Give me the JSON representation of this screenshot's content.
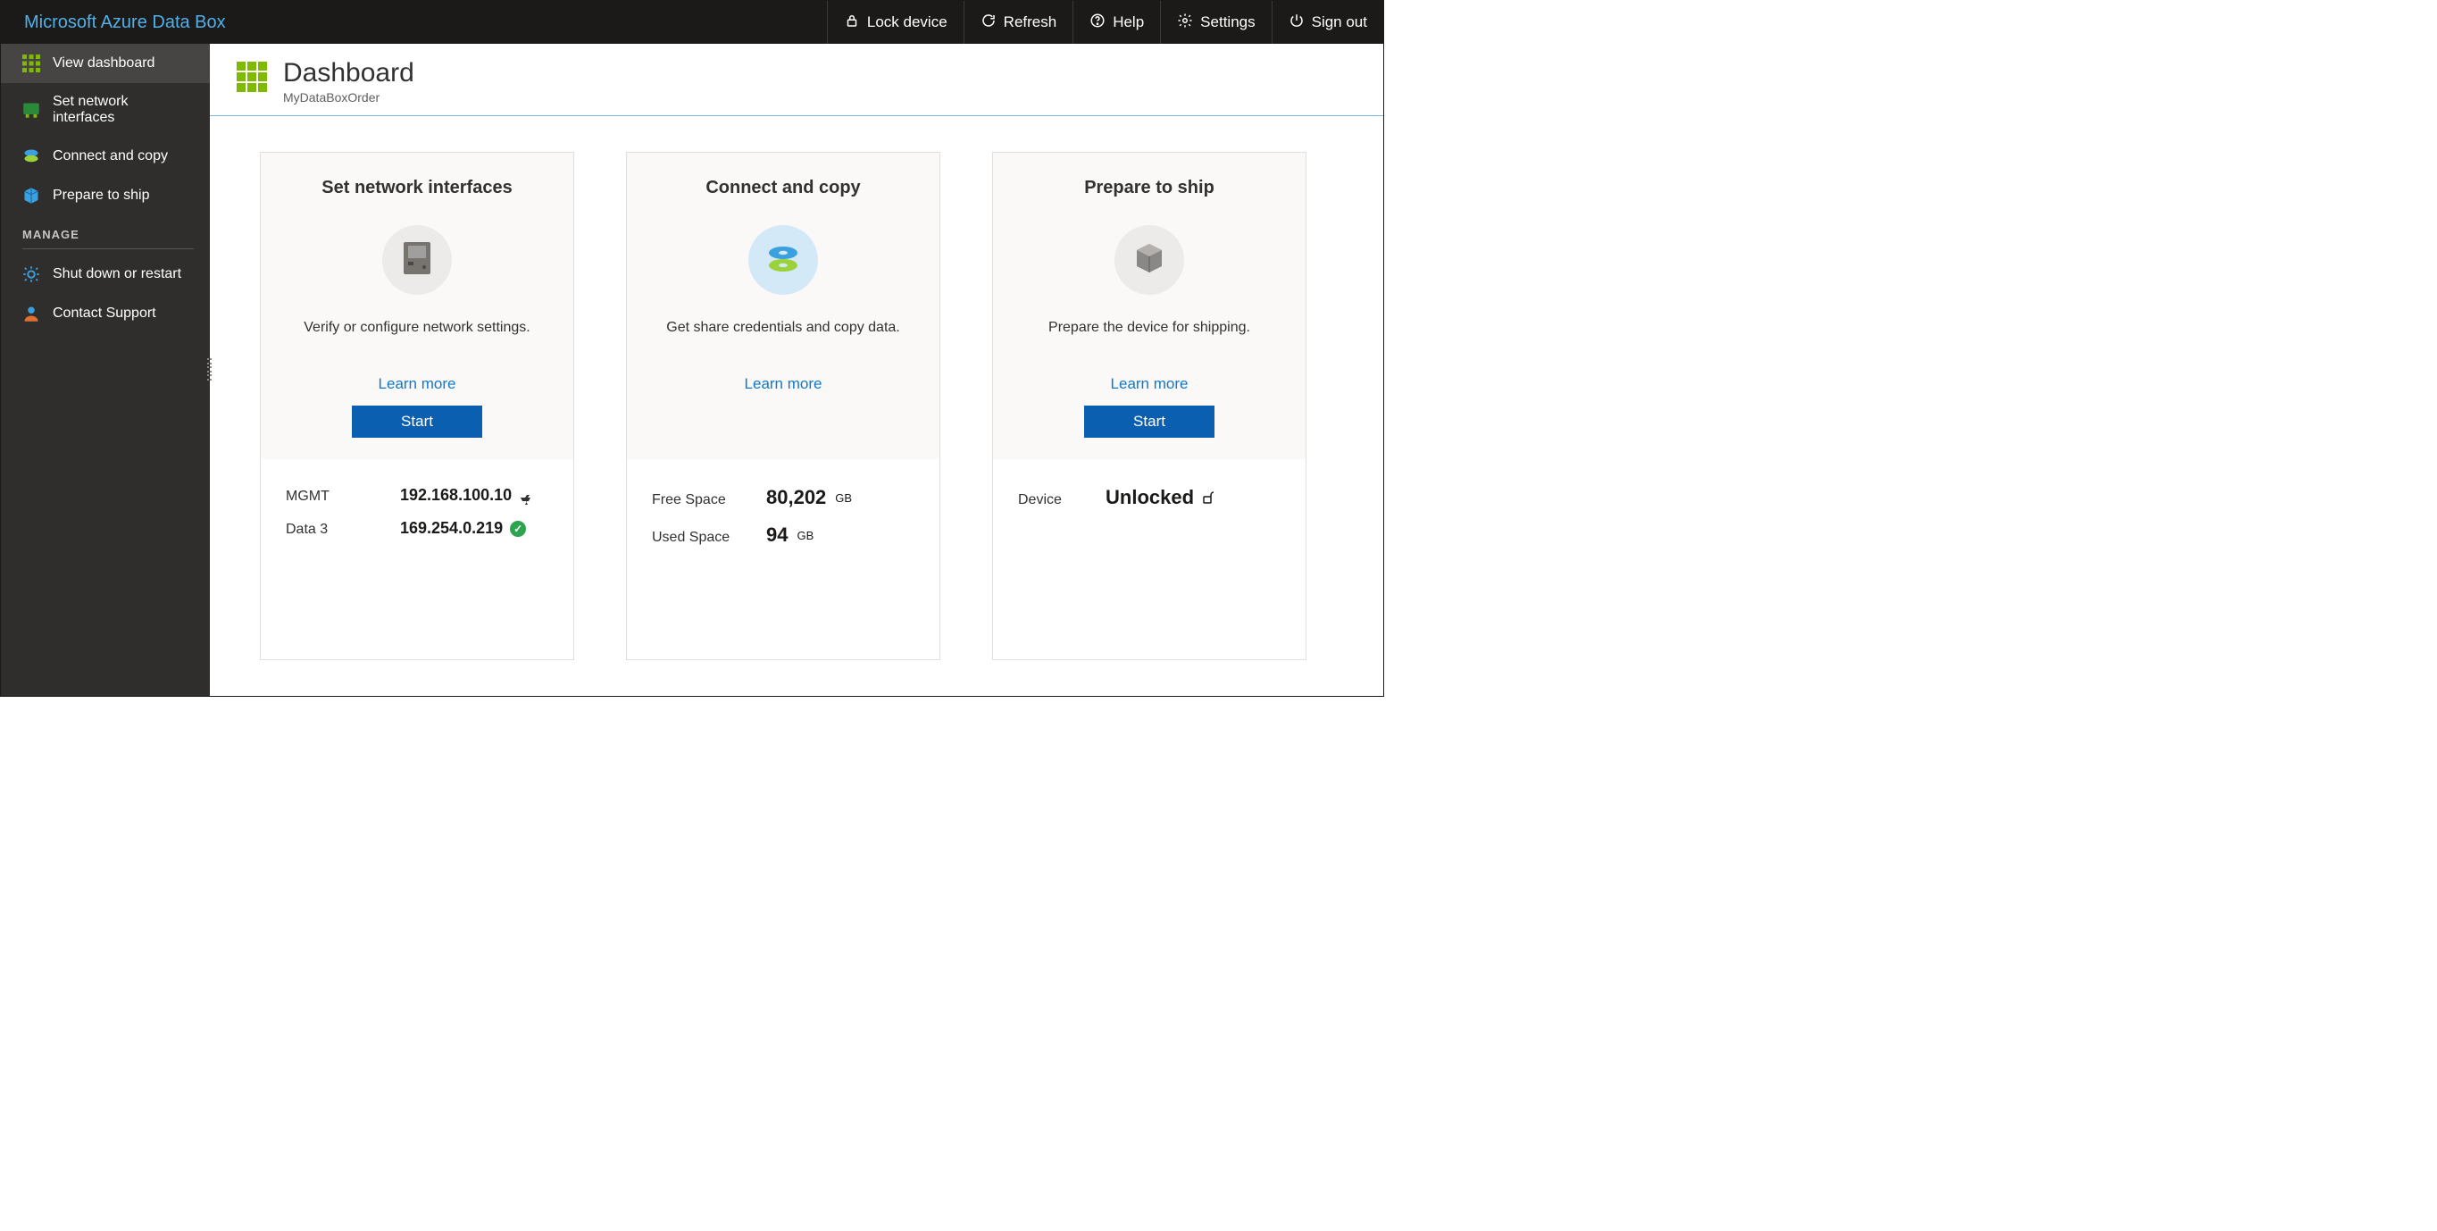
{
  "brand": "Microsoft Azure Data Box",
  "topbar": {
    "lock": "Lock device",
    "refresh": "Refresh",
    "help": "Help",
    "settings": "Settings",
    "signout": "Sign out"
  },
  "sidebar": {
    "items": [
      {
        "label": "View dashboard"
      },
      {
        "label": "Set network interfaces"
      },
      {
        "label": "Connect and copy"
      },
      {
        "label": "Prepare to ship"
      }
    ],
    "manage_heading": "MANAGE",
    "manage_items": [
      {
        "label": "Shut down or restart"
      },
      {
        "label": "Contact Support"
      }
    ]
  },
  "page": {
    "title": "Dashboard",
    "subtitle": "MyDataBoxOrder"
  },
  "cards": {
    "network": {
      "title": "Set network interfaces",
      "desc": "Verify or configure network settings.",
      "learn": "Learn more",
      "start": "Start",
      "rows": [
        {
          "label": "MGMT",
          "value": "192.168.100.10",
          "status": "plug"
        },
        {
          "label": "Data 3",
          "value": "169.254.0.219",
          "status": "ok"
        }
      ]
    },
    "copy": {
      "title": "Connect and copy",
      "desc": "Get share credentials and copy data.",
      "learn": "Learn more",
      "rows": [
        {
          "label": "Free Space",
          "value": "80,202",
          "unit": "GB"
        },
        {
          "label": "Used Space",
          "value": "94",
          "unit": "GB"
        }
      ]
    },
    "ship": {
      "title": "Prepare to ship",
      "desc": "Prepare the device for shipping.",
      "learn": "Learn more",
      "start": "Start",
      "rows": [
        {
          "label": "Device",
          "value": "Unlocked"
        }
      ]
    }
  }
}
